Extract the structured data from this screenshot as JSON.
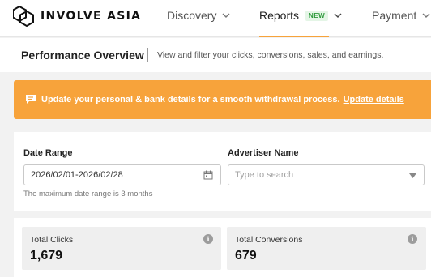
{
  "brand": {
    "name": "INVOLVE ASIA"
  },
  "nav": {
    "items": [
      {
        "label": "Discovery",
        "icon": "chevron-down-icon"
      },
      {
        "label": "Reports",
        "badge": "NEW",
        "icon": "chevron-down-icon",
        "active": true
      },
      {
        "label": "Payment",
        "icon": "chevron-down-icon"
      }
    ],
    "accent_color": "#f7a33b"
  },
  "page": {
    "title": "Performance Overview",
    "subtitle": "View and filter your clicks, conversions, sales, and earnings."
  },
  "banner": {
    "icon": "message-icon",
    "text": "Update your personal & bank details for a smooth withdrawal process.",
    "link_label": "Update details",
    "bg_color": "#f7a33b"
  },
  "filters": {
    "date_range": {
      "label": "Date Range",
      "value": "2026/02/01-2026/02/28",
      "hint": "The maximum date range is 3 months",
      "icon": "calendar-icon"
    },
    "advertiser": {
      "label": "Advertiser Name",
      "placeholder": "Type to search",
      "icon": "chevron-down-icon"
    }
  },
  "stats": [
    {
      "label": "Total Clicks",
      "value": "1,679",
      "icon": "info-icon"
    },
    {
      "label": "Total Conversions",
      "value": "679",
      "icon": "info-icon"
    }
  ]
}
